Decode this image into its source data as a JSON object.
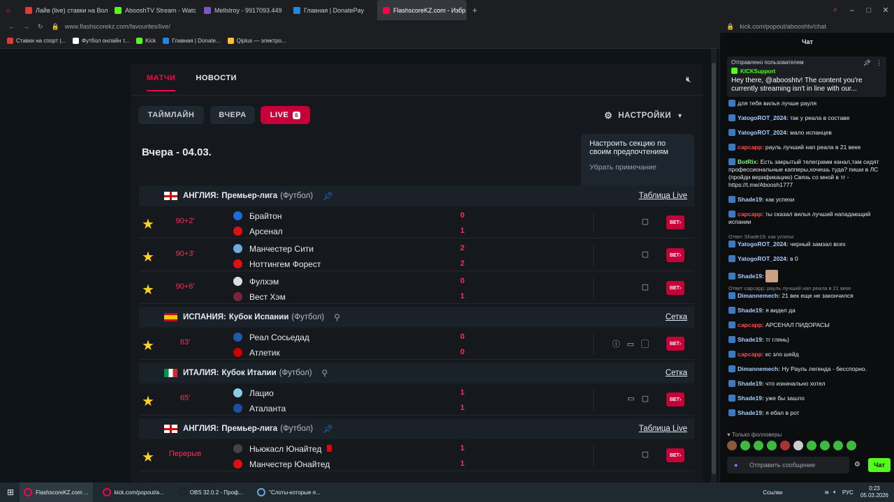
{
  "browser": {
    "tabs": [
      {
        "label": "Лайв (live) ставки на Вол",
        "color": "#e53935"
      },
      {
        "label": "AbooshTV Stream - Watc",
        "color": "#53fc18"
      },
      {
        "label": "Mellstroy - 9917093.449",
        "color": "#7e57c2"
      },
      {
        "label": "Главная | DonatePay",
        "color": "#1e88e5"
      },
      {
        "label": "FlashscoreKZ.com - Избр",
        "color": "#ff0046"
      }
    ],
    "url": "www.flashscorekz.com/favourites/live/",
    "chat_url": "kick.com/popout/abooshtv/chat",
    "bookmarks": [
      {
        "label": "Ставки на спорт |...",
        "color": "#e53935"
      },
      {
        "label": "Футбол онлайн т...",
        "color": "#fff"
      },
      {
        "label": "Kick",
        "color": "#53fc18"
      },
      {
        "label": "Главная | Donate...",
        "color": "#1e88e5"
      },
      {
        "label": "Qiplus — электро...",
        "color": "#fbc02d"
      }
    ]
  },
  "site": {
    "nav": {
      "matches": "МАТЧИ",
      "news": "НОВОСТИ"
    },
    "chips": {
      "timeline": "ТАЙМЛАЙН",
      "yesterday": "ВЧЕРА",
      "live": "LIVE",
      "live_count": "6"
    },
    "settings": "НАСТРОЙКИ",
    "date_header": "Вчера - 04.03.",
    "tooltip": {
      "text": "Настроить секцию по своим предпочтениям",
      "dismiss": "Убрать примечание"
    },
    "leagues": [
      {
        "country": "АНГЛИЯ:",
        "name": "Премьер-лига",
        "sport": "(Футбол)",
        "link": "Таблица Live",
        "flag": "eng"
      },
      {
        "country": "ИСПАНИЯ:",
        "name": "Кубок Испании",
        "sport": "(Футбол)",
        "link": "Сетка",
        "flag": "esp"
      },
      {
        "country": "ИТАЛИЯ:",
        "name": "Кубок Италии",
        "sport": "(Футбол)",
        "link": "Сетка",
        "flag": "ita"
      },
      {
        "country": "АНГЛИЯ:",
        "name": "Премьер-лига",
        "sport": "(Футбол)",
        "link": "Таблица Live",
        "flag": "eng"
      }
    ],
    "matches": [
      {
        "time": "90+2'",
        "home": "Брайтон",
        "away": "Арсенал",
        "hs": "0",
        "as": "1",
        "icons": "▢"
      },
      {
        "time": "90+3'",
        "home": "Манчестер Сити",
        "away": "Ноттингем Форест",
        "hs": "2",
        "as": "2",
        "icons": "▢"
      },
      {
        "time": "90+6'",
        "home": "Фулхэм",
        "away": "Вест Хэм",
        "hs": "0",
        "as": "1",
        "icons": "▢"
      },
      {
        "time": "63'",
        "home": "Реал Сосьедад",
        "away": "Атлетик",
        "hs": "0",
        "as": "0",
        "icons": "ⓘ▭▢"
      },
      {
        "time": "65'",
        "home": "Лацио",
        "away": "Аталанта",
        "hs": "1",
        "as": "1",
        "icons": "▭▢"
      },
      {
        "time": "Перерыв",
        "home": "Ньюкасл Юнайтед",
        "away": "Манчестер Юнайтед",
        "hs": "1",
        "as": "1",
        "icons": "▢"
      }
    ],
    "bet_label": "BET›"
  },
  "chat": {
    "title": "Чат",
    "pinned_by": "Отправлено пользователем",
    "pinned_user": "KICKSupport",
    "pinned_msg": "Hey there, @abooshtv! The content you're currently streaming isn't in line with our...",
    "messages": [
      {
        "user": "",
        "text": "для тебя вилья лучше рауля",
        "style": ""
      },
      {
        "user": "YatogoROT_2024:",
        "text": "так у реала в составе",
        "style": ""
      },
      {
        "user": "YatogoROT_2024:",
        "text": "мало испанцев",
        "style": ""
      },
      {
        "user": "сарсарр:",
        "text": "рауль лучший нап реала в 21 веке",
        "style": "red"
      },
      {
        "user": "BotRix:",
        "text": "Есть закрытый телеграмм канал,там сидят профессиональные капперы,хочешь туда? пиши в ЛС (пройди верификацию) Связь со мной в тг - https://t.me/Aboosh1777",
        "style": "grn"
      },
      {
        "user": "Shade19:",
        "text": "как успехи",
        "style": ""
      },
      {
        "user": "сарсарр:",
        "text": "ты сказал вилья лучший нападающий испании",
        "style": "red"
      },
      {
        "reply": "Ответ Shade19: как успехи",
        "user": "YatogoROT_2024:",
        "text": "черный замзал всех",
        "style": ""
      },
      {
        "user": "YatogoROT_2024:",
        "text": "в 0",
        "style": ""
      },
      {
        "user": "Shade19:",
        "text": "",
        "style": ""
      },
      {
        "reply": "Ответ сарсарр: рауль лучший нап реала в 21 веке",
        "user": "Dimannemech:",
        "text": "21 век еще не закончился",
        "style": ""
      },
      {
        "user": "Shade19:",
        "text": "я видел да",
        "style": ""
      },
      {
        "user": "сарсарр:",
        "text": "АРСЕНАЛ ПИДОРАСЫ",
        "style": "red"
      },
      {
        "user": "Shade19:",
        "text": "тг глянь)",
        "style": ""
      },
      {
        "user": "сарсарр:",
        "text": "кс зло шейд",
        "style": "red"
      },
      {
        "user": "Dimannemech:",
        "text": "Ну Рауль легенда - бесспорно.",
        "style": ""
      },
      {
        "user": "Shade19:",
        "text": "что изначально хотел",
        "style": ""
      },
      {
        "user": "Shade19:",
        "text": "уже бы зашло",
        "style": ""
      },
      {
        "user": "Shade19:",
        "text": "я ебал в рот",
        "style": ""
      }
    ],
    "followers_only": "Только фолловеры",
    "send_placeholder": "Отправить сообщение",
    "send_button": "Чат"
  },
  "taskbar": {
    "items": [
      {
        "label": "FlashscoreKZ.com ...",
        "color": "#ff0046"
      },
      {
        "label": "kick.com/popout/a...",
        "color": "#ff0046"
      },
      {
        "label": "OBS 32.0.2 - Проф...",
        "color": "#222"
      },
      {
        "label": "\"Слоты-которые я...",
        "color": "#6fa8dc"
      }
    ],
    "tray_links": "Ссылки",
    "lang": "РУС",
    "time": "0:23",
    "date": "05.03.2026"
  }
}
